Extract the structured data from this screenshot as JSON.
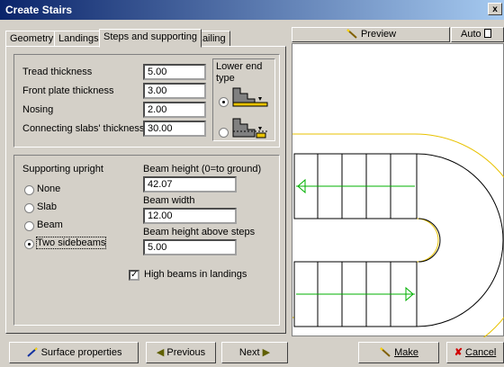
{
  "window": {
    "title": "Create Stairs",
    "close_label": "x"
  },
  "tabs": [
    "Geometry",
    "Landings",
    "Steps and supporting",
    "Railing"
  ],
  "steps": {
    "tread_label": "Tread thickness",
    "tread_value": "5.00",
    "front_plate_label": "Front plate thickness",
    "front_plate_value": "3.00",
    "nosing_label": "Nosing",
    "nosing_value": "2.00",
    "slabs_label": "Connecting slabs' thickness",
    "slabs_value": "30.00",
    "lower_end_label": "Lower end type",
    "lower_end_selected": 1
  },
  "supporting": {
    "label": "Supporting upright",
    "options": [
      "None",
      "Slab",
      "Beam",
      "Two sidebeams"
    ],
    "selected": 3,
    "beam_height_label": "Beam height (0=to ground)",
    "beam_height_value": "42.07",
    "beam_width_label": "Beam width",
    "beam_width_value": "12.00",
    "beam_above_label": "Beam height above steps",
    "beam_above_value": "5.00",
    "high_beams_label": "High beams in landings",
    "high_beams_checked": true
  },
  "buttons": {
    "surface": "Surface properties",
    "previous": "Previous",
    "next": "Next",
    "make": "Make",
    "cancel": "Cancel"
  },
  "preview": {
    "label": "Preview",
    "auto_label": "Auto"
  },
  "icons": {
    "wand": "wand-icon",
    "prev_arrow": "previous-arrow-icon",
    "next_arrow": "next-arrow-icon",
    "cancel": "cancel-x-icon"
  },
  "colors": {
    "title_start": "#0a246a",
    "title_end": "#a6caf0",
    "stair_green": "#00b000",
    "outline_yellow": "#e8c200"
  }
}
